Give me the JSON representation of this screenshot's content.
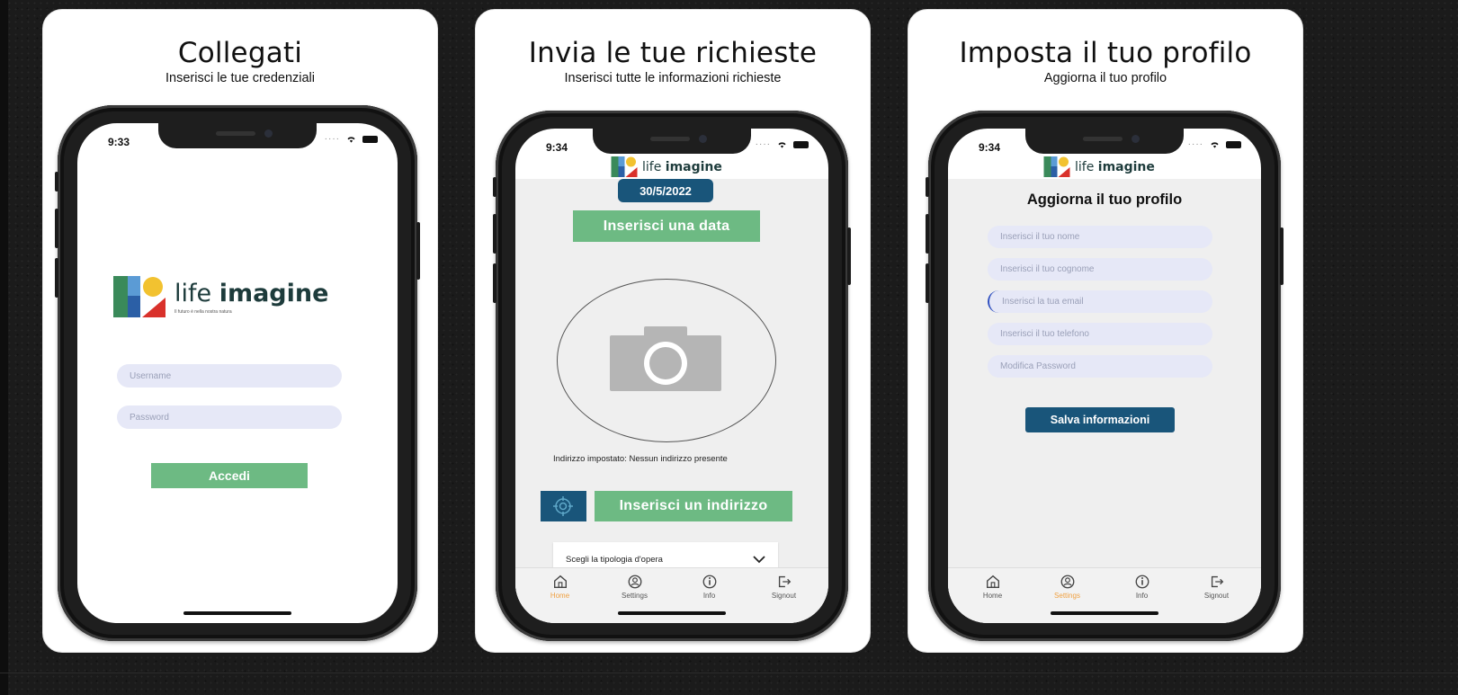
{
  "panels": [
    {
      "title": "Collegati",
      "subtitle": "Inserisci le tue credenziali",
      "time": "9:33",
      "logo": {
        "light": "life ",
        "bold": "imagine",
        "tagline": "Il futuro è nella nostra natura"
      },
      "username_placeholder": "Username",
      "password_placeholder": "Password",
      "login_button": "Accedi"
    },
    {
      "title": "Invia le tue richieste",
      "subtitle": "Inserisci tutte le informazioni richieste",
      "time": "9:34",
      "logo": {
        "light": "life ",
        "bold": "imagine"
      },
      "date_badge": "30/5/2022",
      "date_button": "Inserisci una data",
      "address_text": "Indirizzo impostato: Nessun indirizzo presente",
      "address_button": "Inserisci un indirizzo",
      "select_label": "Scegli la tipologia d'opera",
      "tabs": [
        {
          "label": "Home",
          "icon": "home-icon"
        },
        {
          "label": "Settings",
          "icon": "settings-icon"
        },
        {
          "label": "Info",
          "icon": "info-icon"
        },
        {
          "label": "Signout",
          "icon": "signout-icon"
        }
      ],
      "active_tab": "Home"
    },
    {
      "title": "Imposta il tuo profilo",
      "subtitle": "Aggiorna il tuo profilo",
      "time": "9:34",
      "logo": {
        "light": "life ",
        "bold": "imagine"
      },
      "heading": "Aggiorna il tuo profilo",
      "fields": [
        "Inserisci il tuo nome",
        "Inserisci il tuo cognome",
        "Inserisci la tua email",
        "Inserisci il tuo telefono",
        "Modifica Password"
      ],
      "save_button": "Salva informazioni",
      "tabs": [
        {
          "label": "Home",
          "icon": "home-icon"
        },
        {
          "label": "Settings",
          "icon": "settings-icon"
        },
        {
          "label": "Info",
          "icon": "info-icon"
        },
        {
          "label": "Signout",
          "icon": "signout-icon"
        }
      ],
      "active_tab": "Settings"
    }
  ],
  "colors": {
    "green": "#6dba83",
    "navy": "#19557a",
    "input_bg": "#e6e8f7",
    "active_tab": "#f0a040"
  }
}
